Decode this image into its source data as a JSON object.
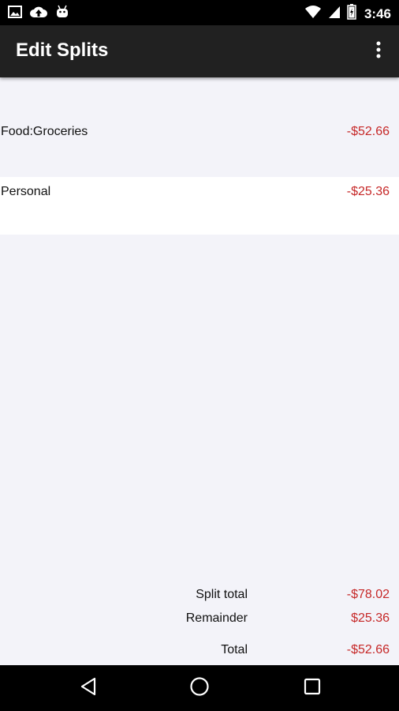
{
  "status_bar": {
    "time": "3:46",
    "left_icons": [
      "image-icon",
      "cloud-upload-icon",
      "android-icon"
    ],
    "right_icons": [
      "wifi-icon",
      "cell-signal-icon",
      "battery-icon"
    ]
  },
  "app_bar": {
    "title": "Edit Splits",
    "overflow_icon": "more-vert-icon"
  },
  "splits": [
    {
      "account": "Food:Groceries",
      "amount": "-$52.66"
    },
    {
      "account": "Personal",
      "amount": "-$25.36"
    }
  ],
  "totals": {
    "split_total_label": "Split total",
    "split_total_value": "-$78.02",
    "remainder_label": "Remainder",
    "remainder_value": "$25.36",
    "total_label": "Total",
    "total_value": "-$52.66"
  },
  "colors": {
    "app_bar_bg": "#212121",
    "content_bg": "#f3f3f9",
    "negative_amount": "#c62828"
  },
  "nav_bar": {
    "icons": [
      "back-icon",
      "home-icon",
      "recents-icon"
    ]
  }
}
